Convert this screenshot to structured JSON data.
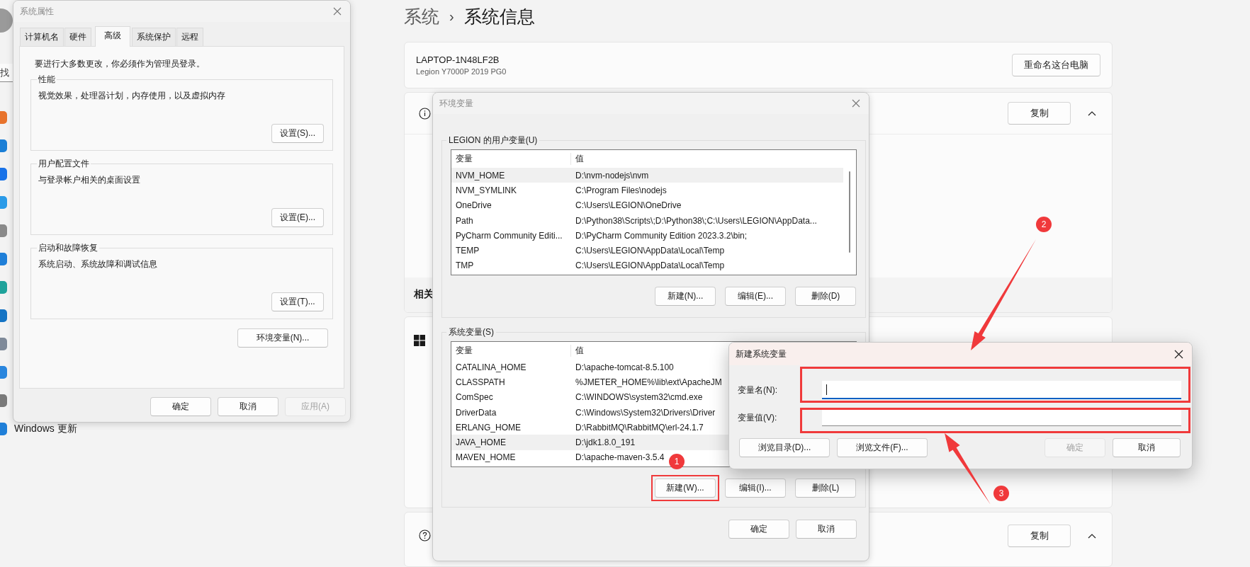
{
  "sidebar": {
    "search": {
      "placeholder": "找"
    },
    "items": [
      {
        "label": "Windows 更新"
      }
    ]
  },
  "settings": {
    "breadcrumb": {
      "parent": "系统",
      "separator": "›",
      "current": "系统信息"
    },
    "device": {
      "name": "LAPTOP-1N48LF2B",
      "model": "Legion Y7000P 2019 PG0",
      "button": "重命名这台电脑"
    },
    "specs": {
      "button": "复制",
      "expanded": true
    },
    "related": {
      "label": "相关"
    },
    "support": {
      "button": "复制",
      "expanded": true
    }
  },
  "system_properties": {
    "title": "系统属性",
    "tabs": [
      {
        "label": "计算机名",
        "selected": false
      },
      {
        "label": "硬件",
        "selected": false
      },
      {
        "label": "高级",
        "selected": true
      },
      {
        "label": "系统保护",
        "selected": false
      },
      {
        "label": "远程",
        "selected": false
      }
    ],
    "notice": "要进行大多数更改，你必须作为管理员登录。",
    "groups": [
      {
        "title": "性能",
        "description": "视觉效果，处理器计划，内存使用，以及虚拟内存",
        "button": "设置(S)..."
      },
      {
        "title": "用户配置文件",
        "description": "与登录帐户相关的桌面设置",
        "button": "设置(E)..."
      },
      {
        "title": "启动和故障恢复",
        "description": "系统启动、系统故障和调试信息",
        "button": "设置(T)..."
      }
    ],
    "env_button": "环境变量(N)...",
    "buttons": [
      {
        "label": "确定",
        "disabled": false
      },
      {
        "label": "取消",
        "disabled": false
      },
      {
        "label": "应用(A)",
        "disabled": true
      }
    ]
  },
  "env_dialog": {
    "title": "环境变量",
    "user_vars": {
      "title": "LEGION 的用户变量(U)",
      "columns": [
        "变量",
        "值"
      ],
      "rows": [
        {
          "name": "NVM_HOME",
          "value": "D:\\nvm-nodejs\\nvm",
          "selected": true
        },
        {
          "name": "NVM_SYMLINK",
          "value": "C:\\Program Files\\nodejs",
          "selected": false
        },
        {
          "name": "OneDrive",
          "value": "C:\\Users\\LEGION\\OneDrive",
          "selected": false
        },
        {
          "name": "Path",
          "value": "D:\\Python38\\Scripts\\;D:\\Python38\\;C:\\Users\\LEGION\\AppData...",
          "selected": false
        },
        {
          "name": "PyCharm Community Editi...",
          "value": "D:\\PyCharm Community Edition 2023.3.2\\bin;",
          "selected": false
        },
        {
          "name": "TEMP",
          "value": "C:\\Users\\LEGION\\AppData\\Local\\Temp",
          "selected": false
        },
        {
          "name": "TMP",
          "value": "C:\\Users\\LEGION\\AppData\\Local\\Temp",
          "selected": false
        }
      ],
      "buttons": [
        {
          "label": "新建(N)...",
          "highlighted": false
        },
        {
          "label": "编辑(E)...",
          "highlighted": false
        },
        {
          "label": "删除(D)",
          "highlighted": false
        }
      ]
    },
    "system_vars": {
      "title": "系统变量(S)",
      "columns": [
        "变量",
        "值"
      ],
      "rows": [
        {
          "name": "CATALINA_HOME",
          "value": "D:\\apache-tomcat-8.5.100",
          "selected": false
        },
        {
          "name": "CLASSPATH",
          "value": "%JMETER_HOME%\\lib\\ext\\ApacheJM",
          "selected": false
        },
        {
          "name": "ComSpec",
          "value": "C:\\WINDOWS\\system32\\cmd.exe",
          "selected": false
        },
        {
          "name": "DriverData",
          "value": "C:\\Windows\\System32\\Drivers\\Driver",
          "selected": false
        },
        {
          "name": "ERLANG_HOME",
          "value": "D:\\RabbitMQ\\RabbitMQ\\erl-24.1.7",
          "selected": false
        },
        {
          "name": "JAVA_HOME",
          "value": "D:\\jdk1.8.0_191",
          "selected": true
        },
        {
          "name": "MAVEN_HOME",
          "value": "D:\\apache-maven-3.5.4",
          "selected": false
        }
      ],
      "buttons": [
        {
          "label": "新建(W)...",
          "highlighted": true
        },
        {
          "label": "编辑(I)...",
          "highlighted": false
        },
        {
          "label": "删除(L)",
          "highlighted": false
        }
      ]
    },
    "buttons": [
      {
        "label": "确定",
        "disabled": false
      },
      {
        "label": "取消",
        "disabled": false
      }
    ]
  },
  "new_var_dialog": {
    "title": "新建系统变量",
    "fields": [
      {
        "label": "变量名(N):",
        "focused": true,
        "highlighted": true
      },
      {
        "label": "变量值(V):",
        "focused": false,
        "highlighted": true
      }
    ],
    "buttons": [
      {
        "label": "浏览目录(D)...",
        "disabled": false
      },
      {
        "label": "浏览文件(F)...",
        "disabled": false
      },
      {
        "label": "确定",
        "disabled": true
      },
      {
        "label": "取消",
        "disabled": false
      }
    ]
  },
  "annotations": [
    {
      "label": "1",
      "arrow": false
    },
    {
      "label": "2",
      "arrow": true
    },
    {
      "label": "3",
      "arrow": true
    }
  ]
}
